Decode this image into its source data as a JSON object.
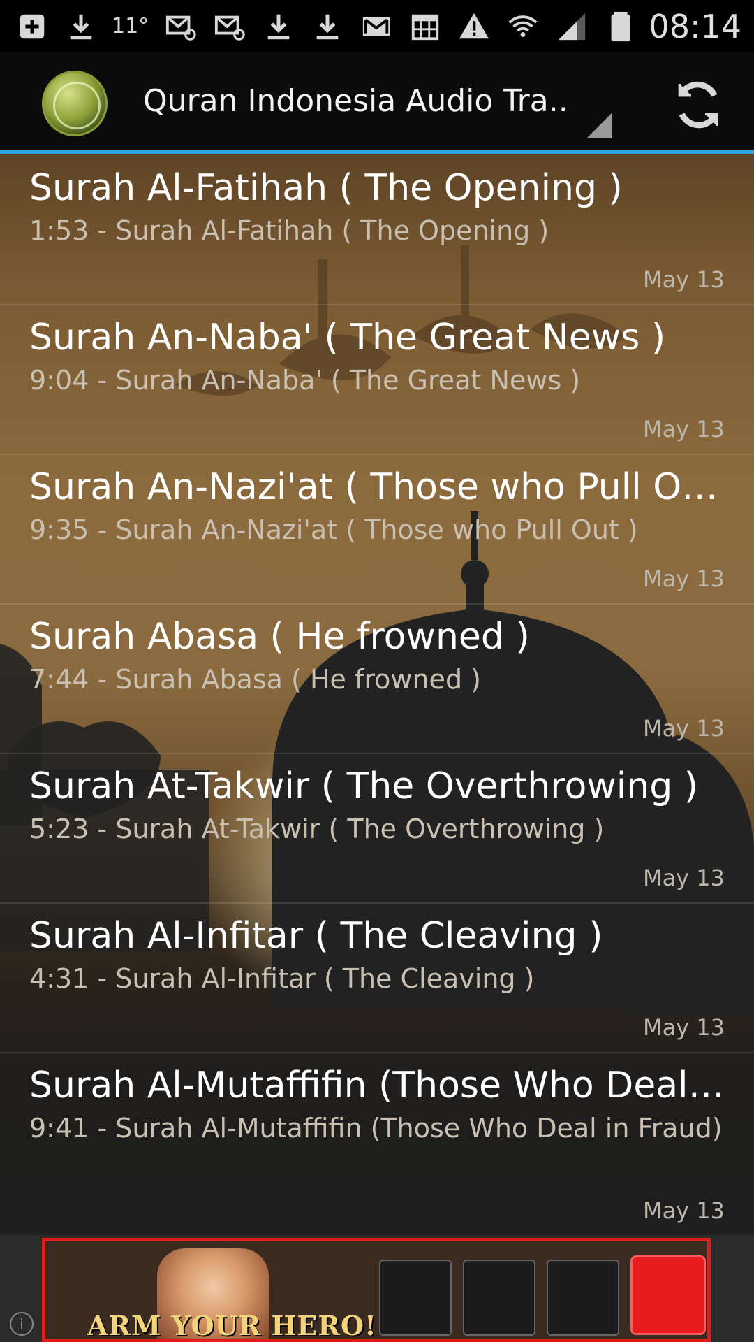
{
  "status_bar": {
    "icons": [
      "add-box-icon",
      "download-icon",
      "temperature",
      "mail-at-icon",
      "mail-at-icon",
      "download-icon",
      "download-icon",
      "gmail-icon",
      "calendar-icon",
      "warning-icon",
      "wifi-icon",
      "signal-icon",
      "battery-icon"
    ],
    "temperature": "11°",
    "time": "08:14"
  },
  "action_bar": {
    "title": "Quran Indonesia Audio Tra..",
    "icon": "quran-logo-icon",
    "refresh_icon": "refresh-icon"
  },
  "list": {
    "items": [
      {
        "title": "Surah Al-Fatihah ( The Opening )",
        "subtitle": "1:53 - Surah Al-Fatihah ( The Opening )",
        "date": "May 13"
      },
      {
        "title": "Surah An-Naba' ( The Great News )",
        "subtitle": "9:04 - Surah An-Naba' ( The Great News )",
        "date": "May 13"
      },
      {
        "title": "Surah An-Nazi'at ( Those who Pull Out )",
        "subtitle": "9:35 - Surah An-Nazi'at ( Those who Pull Out )",
        "date": "May 13"
      },
      {
        "title": "Surah Abasa ( He frowned )",
        "subtitle": "7:44 - Surah Abasa ( He frowned )",
        "date": "May 13"
      },
      {
        "title": "Surah At-Takwir ( The Overthrowing )",
        "subtitle": "5:23 - Surah At-Takwir ( The Overthrowing )",
        "date": "May 13"
      },
      {
        "title": "Surah Al-Infitar ( The Cleaving )",
        "subtitle": "4:31 - Surah Al-Infitar ( The Cleaving )",
        "date": "May 13"
      },
      {
        "title": "Surah Al-Mutaffifin (Those Who Deal in…",
        "subtitle": "9:41 - Surah Al-Mutaffifin (Those Who Deal in Fraud)",
        "date": "May 13"
      }
    ]
  },
  "ad": {
    "text": "ARM YOUR HERO!",
    "info_icon": "info-icon"
  },
  "colors": {
    "accent": "#2aa6d9",
    "ad_border": "#e01d1d"
  }
}
